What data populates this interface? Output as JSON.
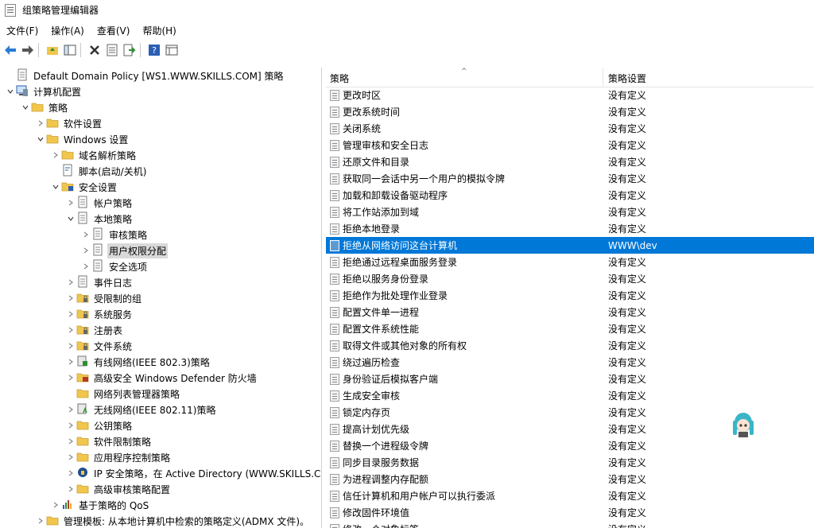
{
  "window": {
    "title": "组策略管理编辑器"
  },
  "menu": [
    "文件(F)",
    "操作(A)",
    "查看(V)",
    "帮助(H)"
  ],
  "toolbar": {
    "icons": [
      "back-icon",
      "forward-icon",
      "up-folder-icon",
      "show-tree-icon",
      "delete-icon",
      "properties-icon",
      "export-icon",
      "help-icon",
      "view-icon"
    ]
  },
  "tree": {
    "nodes": [
      {
        "label": "Default Domain Policy [WS1.WWW.SKILLS.COM] 策略",
        "icon": "policy-doc-icon"
      },
      {
        "label": "计算机配置",
        "icon": "computer-icon"
      },
      {
        "label": "策略",
        "icon": "folder-icon"
      },
      {
        "label": "软件设置",
        "icon": "folder-icon"
      },
      {
        "label": "Windows 设置",
        "icon": "folder-icon"
      },
      {
        "label": "域名解析策略",
        "icon": "folder-icon"
      },
      {
        "label": "脚本(启动/关机)",
        "icon": "script-icon"
      },
      {
        "label": "安全设置",
        "icon": "security-settings-icon"
      },
      {
        "label": "帐户策略",
        "icon": "policy-doc-icon"
      },
      {
        "label": "本地策略",
        "icon": "policy-doc-icon"
      },
      {
        "label": "审核策略",
        "icon": "policy-doc-icon"
      },
      {
        "label": "用户权限分配",
        "icon": "policy-doc-icon"
      },
      {
        "label": "安全选项",
        "icon": "policy-doc-icon"
      },
      {
        "label": "事件日志",
        "icon": "policy-doc-icon"
      },
      {
        "label": "受限制的组",
        "icon": "lock-folder-icon"
      },
      {
        "label": "系统服务",
        "icon": "lock-folder-icon"
      },
      {
        "label": "注册表",
        "icon": "lock-folder-icon"
      },
      {
        "label": "文件系统",
        "icon": "lock-folder-icon"
      },
      {
        "label": "有线网络(IEEE 802.3)策略",
        "icon": "network-policy-icon"
      },
      {
        "label": "高级安全 Windows Defender 防火墙",
        "icon": "firewall-icon"
      },
      {
        "label": "网络列表管理器策略",
        "icon": "folder-icon"
      },
      {
        "label": "无线网络(IEEE 802.11)策略",
        "icon": "wireless-policy-icon"
      },
      {
        "label": "公钥策略",
        "icon": "folder-icon"
      },
      {
        "label": "软件限制策略",
        "icon": "folder-icon"
      },
      {
        "label": "应用程序控制策略",
        "icon": "folder-icon"
      },
      {
        "label": "IP 安全策略，在 Active Directory (WWW.SKILLS.COM)",
        "icon": "ipsec-icon"
      },
      {
        "label": "高级审核策略配置",
        "icon": "folder-icon"
      },
      {
        "label": "基于策略的 QoS",
        "icon": "qos-chart-icon"
      },
      {
        "label": "管理模板: 从本地计算机中检索的策略定义(ADMX 文件)。",
        "icon": "folder-icon"
      }
    ]
  },
  "list": {
    "headers": {
      "policy": "策略",
      "setting": "策略设置"
    },
    "rows": [
      {
        "name": "更改时区",
        "value": "没有定义"
      },
      {
        "name": "更改系统时间",
        "value": "没有定义"
      },
      {
        "name": "关闭系统",
        "value": "没有定义"
      },
      {
        "name": "管理审核和安全日志",
        "value": "没有定义"
      },
      {
        "name": "还原文件和目录",
        "value": "没有定义"
      },
      {
        "name": "获取同一会话中另一个用户的模拟令牌",
        "value": "没有定义"
      },
      {
        "name": "加载和卸载设备驱动程序",
        "value": "没有定义"
      },
      {
        "name": "将工作站添加到域",
        "value": "没有定义"
      },
      {
        "name": "拒绝本地登录",
        "value": "没有定义"
      },
      {
        "name": "拒绝从网络访问这台计算机",
        "value": "WWW\\dev"
      },
      {
        "name": "拒绝通过远程桌面服务登录",
        "value": "没有定义"
      },
      {
        "name": "拒绝以服务身份登录",
        "value": "没有定义"
      },
      {
        "name": "拒绝作为批处理作业登录",
        "value": "没有定义"
      },
      {
        "name": "配置文件单一进程",
        "value": "没有定义"
      },
      {
        "name": "配置文件系统性能",
        "value": "没有定义"
      },
      {
        "name": "取得文件或其他对象的所有权",
        "value": "没有定义"
      },
      {
        "name": "绕过遍历检查",
        "value": "没有定义"
      },
      {
        "name": "身份验证后模拟客户端",
        "value": "没有定义"
      },
      {
        "name": "生成安全审核",
        "value": "没有定义"
      },
      {
        "name": "锁定内存页",
        "value": "没有定义"
      },
      {
        "name": "提高计划优先级",
        "value": "没有定义"
      },
      {
        "name": "替换一个进程级令牌",
        "value": "没有定义"
      },
      {
        "name": "同步目录服务数据",
        "value": "没有定义"
      },
      {
        "name": "为进程调整内存配额",
        "value": "没有定义"
      },
      {
        "name": "信任计算机和用户帐户可以执行委派",
        "value": "没有定义"
      },
      {
        "name": "修改固件环境值",
        "value": "没有定义"
      },
      {
        "name": "修改一个对象标签",
        "value": "没有定义"
      }
    ]
  },
  "colors": {
    "selection": "#0078d7",
    "tree_selection": "#d9d9d9",
    "folder": "#f1c64d"
  },
  "overlay": {
    "icon": "mascot-icon"
  }
}
